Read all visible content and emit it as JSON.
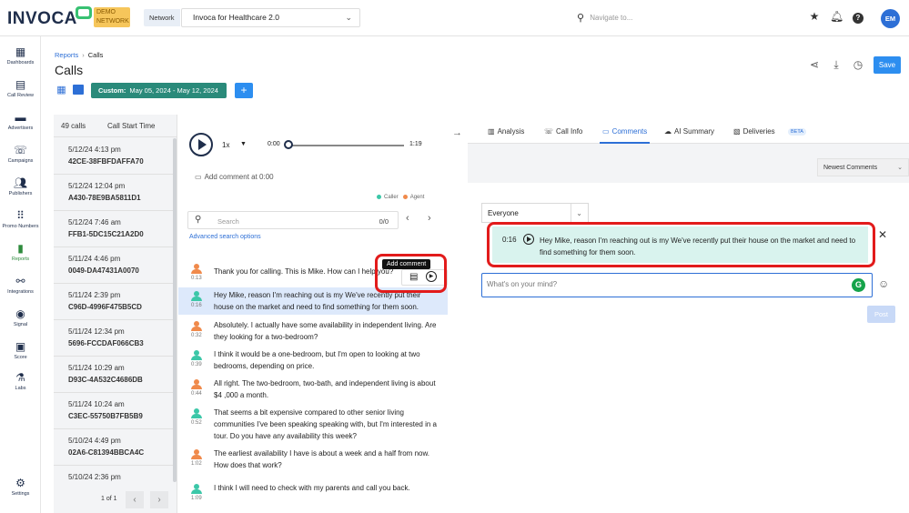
{
  "top": {
    "logo": "INVOCA",
    "demo_badge": "DEMO NETWORK",
    "network_label": "Network",
    "network_value": "Invoca for Healthcare 2.0",
    "search_placeholder": "Navigate to...",
    "avatar": "EM"
  },
  "sidebar": [
    {
      "label": "Dashboards",
      "icon": "dashboard-icon"
    },
    {
      "label": "Call Review",
      "icon": "call-review-icon"
    },
    {
      "label": "Advertisers",
      "icon": "advertisers-icon"
    },
    {
      "label": "Campaigns",
      "icon": "campaigns-icon"
    },
    {
      "label": "Publishers",
      "icon": "publishers-icon"
    },
    {
      "label": "Promo Numbers",
      "icon": "promo-numbers-icon"
    },
    {
      "label": "Reports",
      "icon": "reports-icon"
    },
    {
      "label": "Integrations",
      "icon": "integrations-icon"
    },
    {
      "label": "Signal",
      "icon": "signal-icon"
    },
    {
      "label": "Score",
      "icon": "score-icon"
    },
    {
      "label": "Labs",
      "icon": "labs-icon"
    },
    {
      "label": "Settings",
      "icon": "settings-icon"
    }
  ],
  "header": {
    "breadcrumb_root": "Reports",
    "breadcrumb_current": "Calls",
    "title": "Calls",
    "date_label": "Custom:",
    "date_range": "May 05, 2024 - May 12, 2024",
    "add_label": "+",
    "save_label": "Save"
  },
  "calls": {
    "count": "49 calls",
    "sort_label": "Call Start Time",
    "items": [
      {
        "date": "5/12/24 4:13 pm",
        "id": "42CE-38FBFDAFFA70"
      },
      {
        "date": "5/12/24 12:04 pm",
        "id": "A430-78E9BA5811D1"
      },
      {
        "date": "5/12/24 7:46 am",
        "id": "FFB1-5DC15C21A2D0"
      },
      {
        "date": "5/11/24 4:46 pm",
        "id": "0049-DA47431A0070"
      },
      {
        "date": "5/11/24 2:39 pm",
        "id": "C96D-4996F475B5CD"
      },
      {
        "date": "5/11/24 12:34 pm",
        "id": "5696-FCCDAF066CB3"
      },
      {
        "date": "5/11/24 10:29 am",
        "id": "D93C-4A532C4686DB"
      },
      {
        "date": "5/11/24 10:24 am",
        "id": "C3EC-55750B7FB5B9"
      },
      {
        "date": "5/10/24 4:49 pm",
        "id": "02A6-C81394BBCA4C"
      },
      {
        "date": "5/10/24 2:36 pm",
        "id": ""
      }
    ],
    "page": "1 of 1"
  },
  "player": {
    "speed": "1x",
    "time_start": "0:00",
    "time_end": "1:19",
    "progress": 0.0
  },
  "transcript": {
    "add_comment_at": "Add comment at 0:00",
    "legend_caller": "Caller",
    "legend_agent": "Agent",
    "search_placeholder": "Search",
    "search_count": "0/0",
    "advanced_search": "Advanced search options",
    "tooltip": "Add comment",
    "messages": [
      {
        "speaker": "agent",
        "time": "0:13",
        "text": "Thank you for calling. This is Mike. How can I help you?"
      },
      {
        "speaker": "caller",
        "time": "0:16",
        "text": "Hey Mike, reason I'm reaching out is my We've recently put their house on the market and need to find something for them soon."
      },
      {
        "speaker": "agent",
        "time": "0:32",
        "text": "Absolutely. I actually have some availability in independent living. Are they looking for a two-bedroom?"
      },
      {
        "speaker": "caller",
        "time": "0:39",
        "text": "I think it would be a one-bedroom, but I'm open to looking at two bedrooms, depending on price."
      },
      {
        "speaker": "agent",
        "time": "0:44",
        "text": "All right. The two-bedroom, two-bath, and independent living is about $4 ,000 a month."
      },
      {
        "speaker": "caller",
        "time": "0:52",
        "text": "That seems a bit expensive compared to other senior living communities I've been speaking speaking with, but I'm interested in a tour. Do you have any availability this week?"
      },
      {
        "speaker": "agent",
        "time": "1:02",
        "text": "The earliest availability I have is about a week and a half from now. How does that work?"
      },
      {
        "speaker": "caller",
        "time": "1:09",
        "text": "I think I will need to check with my parents and call you back."
      }
    ]
  },
  "tabs": [
    {
      "label": "Analysis",
      "icon": "analysis-icon"
    },
    {
      "label": "Call Info",
      "icon": "phone-icon"
    },
    {
      "label": "Comments",
      "icon": "comments-icon"
    },
    {
      "label": "AI Summary",
      "icon": "cloud-icon"
    },
    {
      "label": "Deliveries",
      "icon": "deliveries-icon"
    }
  ],
  "beta": "BETA",
  "comments": {
    "sort": "Newest Comments",
    "audience": "Everyone",
    "item_time": "0:16",
    "item_text": "Hey Mike, reason I'm reaching out is my We've recently put their house on the market and need to find something for them soon.",
    "compose_placeholder": "What's on your mind?",
    "post_label": "Post"
  },
  "colors": {
    "caller": "#3cc7a8",
    "agent": "#f08a4b",
    "accent": "#2d6fd6",
    "highlight": "#d9f3ee",
    "annotation": "#e21b1b"
  }
}
